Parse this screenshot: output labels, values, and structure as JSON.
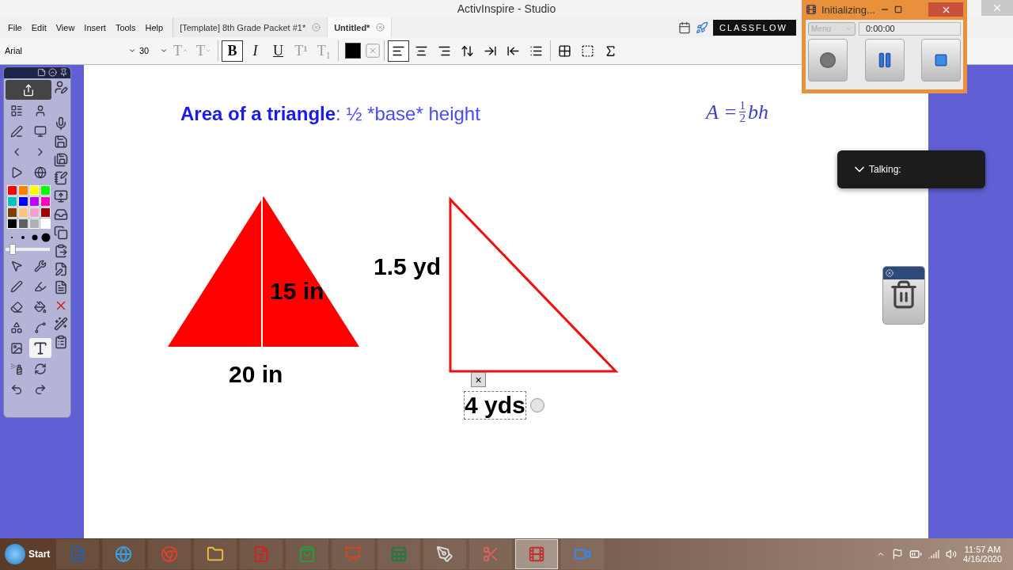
{
  "window": {
    "title": "ActivInspire - Studio"
  },
  "menu": [
    "File",
    "Edit",
    "View",
    "Insert",
    "Tools",
    "Help"
  ],
  "tabs": [
    {
      "label": "[Template] 8th Grade Packet #1*",
      "selected": false
    },
    {
      "label": "Untitled*",
      "selected": true
    }
  ],
  "classflow": {
    "label": "CLASSFLOW"
  },
  "font": {
    "name": "Arial",
    "size": "30"
  },
  "format_tools": [
    {
      "kind": "grow",
      "text": "T",
      "disabled": true,
      "selected": false
    },
    {
      "kind": "shrink",
      "text": "T",
      "disabled": true,
      "selected": false
    },
    {
      "kind": "separator"
    },
    {
      "kind": "bold",
      "text": "B",
      "disabled": false,
      "selected": true
    },
    {
      "kind": "italic",
      "text": "I",
      "disabled": false,
      "selected": false
    },
    {
      "kind": "underline",
      "text": "U",
      "disabled": false,
      "selected": false
    },
    {
      "kind": "superscript",
      "text": "T¹",
      "disabled": true,
      "selected": false
    },
    {
      "kind": "subscript",
      "text": "T₁",
      "disabled": true,
      "selected": false
    },
    {
      "kind": "separator"
    },
    {
      "kind": "color",
      "color": "#000000"
    },
    {
      "kind": "no-color"
    },
    {
      "kind": "separator"
    },
    {
      "kind": "align-left",
      "selected": true
    },
    {
      "kind": "align-center",
      "selected": false
    },
    {
      "kind": "align-right",
      "selected": false
    },
    {
      "kind": "line-spacing",
      "selected": false
    },
    {
      "kind": "indent",
      "selected": false
    },
    {
      "kind": "outdent",
      "selected": false
    },
    {
      "kind": "bullets",
      "selected": false
    },
    {
      "kind": "separator"
    },
    {
      "kind": "table",
      "selected": false
    },
    {
      "kind": "select-text",
      "selected": false
    },
    {
      "kind": "equation",
      "selected": false
    }
  ],
  "toolbox": {
    "top_tools": [
      {
        "kind": "share"
      },
      {
        "kind": "flipchart"
      },
      {
        "kind": "profile"
      },
      {
        "kind": "annotate"
      },
      {
        "kind": "desktop"
      },
      {
        "kind": "previous"
      },
      {
        "kind": "next"
      },
      {
        "kind": "play"
      },
      {
        "kind": "globe"
      }
    ],
    "palette": [
      {
        "color": "#ff0000"
      },
      {
        "color": "#ff7f00"
      },
      {
        "color": "#ffff00"
      },
      {
        "color": "#00ff00"
      },
      {
        "color": "#00c0c0"
      },
      {
        "color": "#0000ff"
      },
      {
        "color": "#c000ff"
      },
      {
        "color": "#ff00c0"
      },
      {
        "color": "#804000"
      },
      {
        "color": "#ffc080"
      },
      {
        "color": "#f0a0d0"
      },
      {
        "color": "#a00000"
      },
      {
        "color": "#000000"
      },
      {
        "color": "#606060"
      },
      {
        "color": "#b0b0b0"
      },
      {
        "color": "#ffffff"
      }
    ],
    "pen_width": {
      "level": 0.1
    },
    "tools": [
      {
        "kind": "select",
        "selected": false
      },
      {
        "kind": "tools",
        "selected": false
      },
      {
        "kind": "pen",
        "selected": false
      },
      {
        "kind": "highlighter",
        "selected": false
      },
      {
        "kind": "eraser",
        "selected": false
      },
      {
        "kind": "fill",
        "selected": false
      },
      {
        "kind": "shape",
        "selected": false
      },
      {
        "kind": "connector",
        "selected": false
      },
      {
        "kind": "clip-art",
        "selected": false
      },
      {
        "kind": "text",
        "selected": true
      },
      {
        "kind": "cleaner",
        "selected": false
      },
      {
        "kind": "reset",
        "selected": false
      },
      {
        "kind": "undo",
        "selected": false
      },
      {
        "kind": "redo",
        "selected": false
      }
    ],
    "side_tools": [
      {
        "kind": "user"
      },
      {
        "kind": "blank"
      },
      {
        "kind": "mic"
      },
      {
        "kind": "save"
      },
      {
        "kind": "save-as"
      },
      {
        "kind": "notes"
      },
      {
        "kind": "screen"
      },
      {
        "kind": "drawer"
      },
      {
        "kind": "copy"
      },
      {
        "kind": "paste"
      },
      {
        "kind": "edit"
      },
      {
        "kind": "pdf"
      },
      {
        "kind": "delete"
      },
      {
        "kind": "magic"
      },
      {
        "kind": "clipboard"
      }
    ]
  },
  "page": {
    "heading": {
      "bold": "Area of a triangle",
      "rest": ": ½ *base* height"
    },
    "formula": {
      "lhs": "A =",
      "numerator": "1",
      "denominator": "2",
      "rhs": "bh"
    },
    "labels": [
      {
        "text": "15 in",
        "selected": false
      },
      {
        "text": "20 in",
        "selected": false
      },
      {
        "text": "1.5 yd",
        "selected": false
      },
      {
        "text": "4 yds",
        "selected": true
      }
    ],
    "close_mark": "×"
  },
  "recorder": {
    "title": "Initializing...",
    "menu": "Menu",
    "menu_disabled": true,
    "time": "0:00:00"
  },
  "talking": {
    "label": "Talking:"
  },
  "taskbar": {
    "start": "Start",
    "apps": [
      {
        "kind": "word",
        "selected": false
      },
      {
        "kind": "browser",
        "selected": false
      },
      {
        "kind": "chrome",
        "selected": false
      },
      {
        "kind": "folder",
        "selected": false
      },
      {
        "kind": "pdf",
        "selected": false
      },
      {
        "kind": "store",
        "selected": false
      },
      {
        "kind": "slides",
        "selected": false
      },
      {
        "kind": "sheet",
        "selected": false
      },
      {
        "kind": "inspire",
        "selected": false
      },
      {
        "kind": "snip",
        "selected": false
      },
      {
        "kind": "recorder",
        "selected": true
      },
      {
        "kind": "video",
        "selected": false
      }
    ],
    "time": "11:57 AM",
    "date": "4/16/2020"
  }
}
